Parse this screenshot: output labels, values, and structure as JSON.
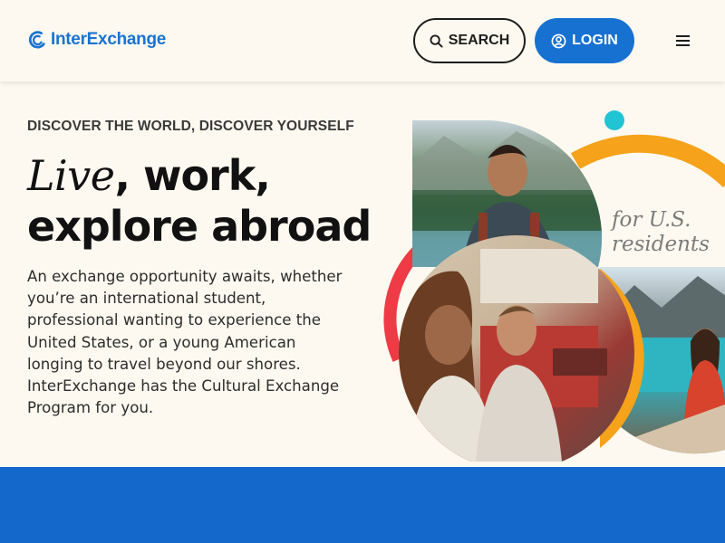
{
  "brand": {
    "name": "InterExchange",
    "color": "#1a73d0"
  },
  "header": {
    "search_label": "SEARCH",
    "search_icon": "search-icon",
    "login_label": "LOGIN",
    "login_icon": "user-circle-icon",
    "menu_icon": "hamburger-icon",
    "login_color": "#1771d1"
  },
  "hero": {
    "eyebrow": "DISCOVER THE WORLD, DISCOVER YOURSELF",
    "headline_live": "Live",
    "headline_rest1": ", work,",
    "headline_line2": "explore abroad",
    "body": "An exchange opportunity awaits, whether you’re an international student, professional wanting to experience the United States, or a young American longing to travel beyond our shores. InterExchange has the Cultural Exchange Program for you.",
    "badge_line1": "for U.S.",
    "badge_line2": "residents"
  },
  "colors": {
    "background": "#fdf9f0",
    "accent_orange": "#f6a21a",
    "accent_red": "#ee3b45",
    "accent_teal": "#21c4d3",
    "band_blue": "#1468cc"
  }
}
